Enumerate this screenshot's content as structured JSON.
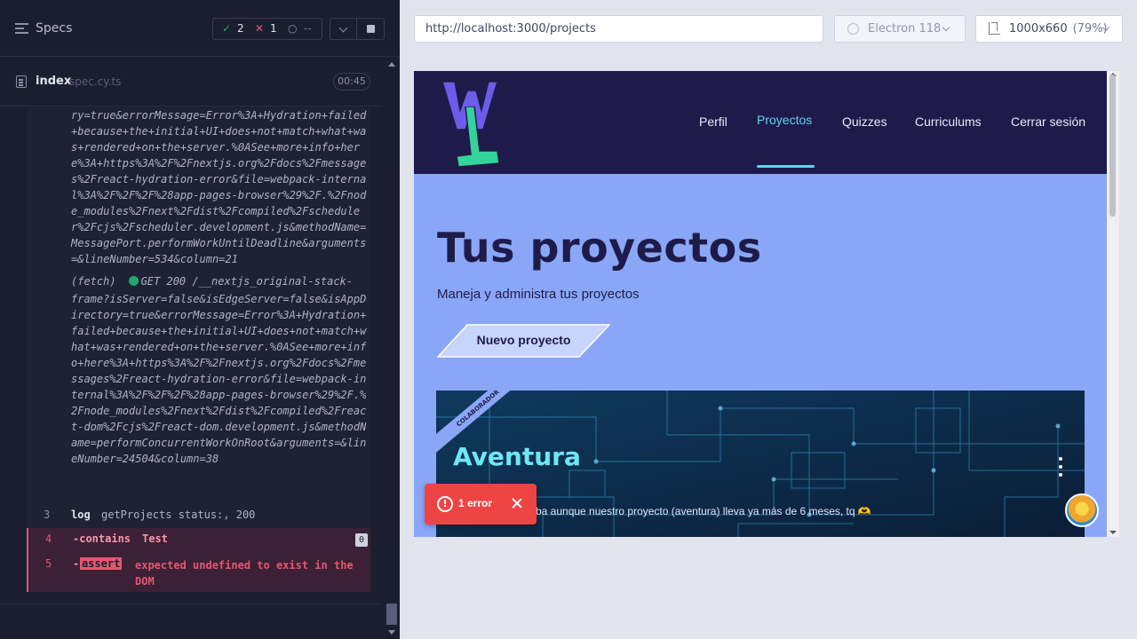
{
  "reporter": {
    "title": "Specs",
    "stats": {
      "passed": "2",
      "failed": "1",
      "pending": "--"
    },
    "spec": {
      "name": "index",
      "ext": "spec.cy.ts",
      "duration": "00:45"
    },
    "log": {
      "block1": "ry=true&errorMessage=Error%3A+Hydration+failed+because+the+initial+UI+does+not+match+what+was+rendered+on+the+server.%0ASee+more+info+here%3A+https%3A%2F%2Fnextjs.org%2Fdocs%2Fmessages%2Freact-hydration-error&file=webpack-internal%3A%2F%2F%2F%28app-pages-browser%29%2F.%2Fnode_modules%2Fnext%2Fdist%2Fcompiled%2Fscheduler%2Fcjs%2Fscheduler.development.js&methodName=MessagePort.performWorkUntilDeadline&arguments=&lineNumber=534&column=21",
      "fetch_tag": "(fetch)",
      "fetch_request": "GET 200 /__nextjs_original-stack-",
      "block2": "frame?isServer=false&isEdgeServer=false&isAppDirectory=true&errorMessage=Error%3A+Hydration+failed+because+the+initial+UI+does+not+match+what+was+rendered+on+the+server.%0ASee+more+info+here%3A+https%3A%2F%2Fnextjs.org%2Fdocs%2Fmessages%2Freact-hydration-error&file=webpack-internal%3A%2F%2F%2F%28app-pages-browser%29%2F.%2Fnode_modules%2Fnext%2Fdist%2Fcompiled%2Freact-dom%2Fcjs%2Freact-dom.development.js&methodName=performConcurrentWorkOnRoot&arguments=&lineNumber=24504&column=38"
    },
    "commands": [
      {
        "num": "3",
        "name": "log",
        "msg": "getProjects status:, 200"
      },
      {
        "num": "4",
        "name": "-contains",
        "msg": "Test",
        "badge": "0"
      },
      {
        "num": "5",
        "name": "-",
        "tag": "assert",
        "msg": "expected undefined to exist in the DOM"
      }
    ]
  },
  "runner": {
    "url": "http://localhost:3000/projects",
    "browser": "Electron 118",
    "viewport": "1000x660",
    "zoom": "(79%)"
  },
  "app": {
    "nav": [
      "Perfil",
      "Proyectos",
      "Quizzes",
      "Curriculums",
      "Cerrar sesión"
    ],
    "active_nav": "Proyectos",
    "title": "Tus proyectos",
    "subtitle": "Maneja y administra tus proyectos",
    "new_button": "Nuevo proyecto",
    "card": {
      "ribbon": "COLABORADOR",
      "title": "Aventura",
      "role": "",
      "desc": "ba aunque nuestro proyecto (aventura) lleva ya más de 6 meses, tq 🫶"
    },
    "error_toast": "1 error",
    "colors": {
      "nav_bg": "#1e1b4b",
      "page_bg": "#8aa7f7",
      "accent": "#5ed3f3",
      "error": "#ef4444"
    }
  }
}
